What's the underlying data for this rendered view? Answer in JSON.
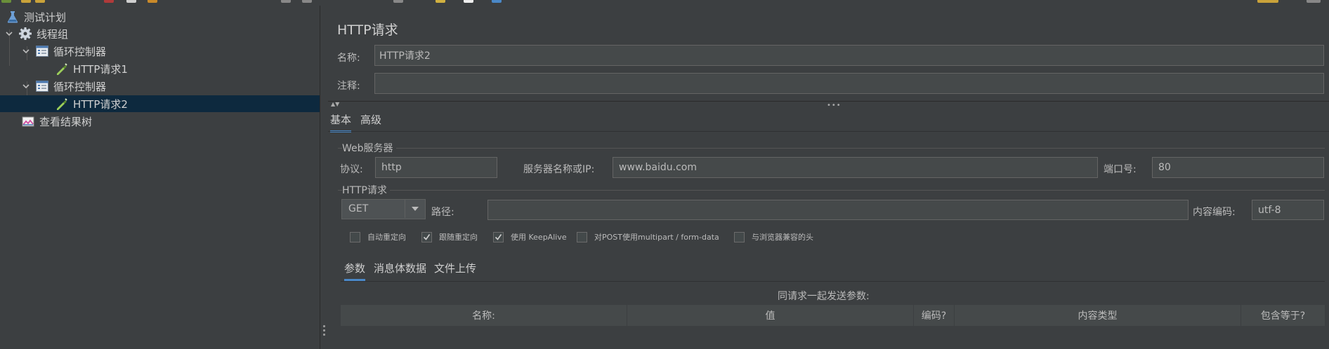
{
  "tree": {
    "items": [
      {
        "label": "测试计划",
        "icon": "flask-icon"
      },
      {
        "label": "线程组",
        "icon": "gear-icon"
      },
      {
        "label": "循环控制器",
        "icon": "loop-controller-icon"
      },
      {
        "label": "HTTP请求1",
        "icon": "sampler-pipette-icon"
      },
      {
        "label": "循环控制器",
        "icon": "loop-controller-icon"
      },
      {
        "label": "HTTP请求2",
        "icon": "sampler-pipette-icon"
      },
      {
        "label": "查看结果树",
        "icon": "results-chart-icon"
      }
    ]
  },
  "panel": {
    "title": "HTTP请求",
    "name_label": "名称:",
    "name_value": "HTTP请求2",
    "comment_label": "注释:",
    "comment_value": "",
    "tabs": [
      "基本",
      "高级"
    ],
    "web_server": {
      "title": "Web服务器",
      "protocol_label": "协议:",
      "protocol_value": "http",
      "server_label": "服务器名称或IP:",
      "server_value": "www.baidu.com",
      "port_label": "端口号:",
      "port_value": "80"
    },
    "http_request": {
      "title": "HTTP请求",
      "method": "GET",
      "path_label": "路径:",
      "path_value": "",
      "encoding_label": "内容编码:",
      "encoding_value": "utf-8"
    },
    "checkboxes": [
      {
        "label": "自动重定向",
        "checked": false
      },
      {
        "label": "跟随重定向",
        "checked": true
      },
      {
        "label": "使用 KeepAlive",
        "checked": true
      },
      {
        "label": "对POST使用multipart / form-data",
        "checked": false
      },
      {
        "label": "与浏览器兼容的头",
        "checked": false
      }
    ],
    "sub_tabs": [
      "参数",
      "消息体数据",
      "文件上传"
    ],
    "params_note": "同请求一起发送参数:",
    "table_headers": [
      "名称:",
      "值",
      "编码?",
      "内容类型",
      "包含等于?"
    ]
  },
  "colors": {
    "background": "#3c3f41",
    "selection": "#0d293e",
    "accent": "#4a88c7",
    "field_bg": "#45494a"
  }
}
